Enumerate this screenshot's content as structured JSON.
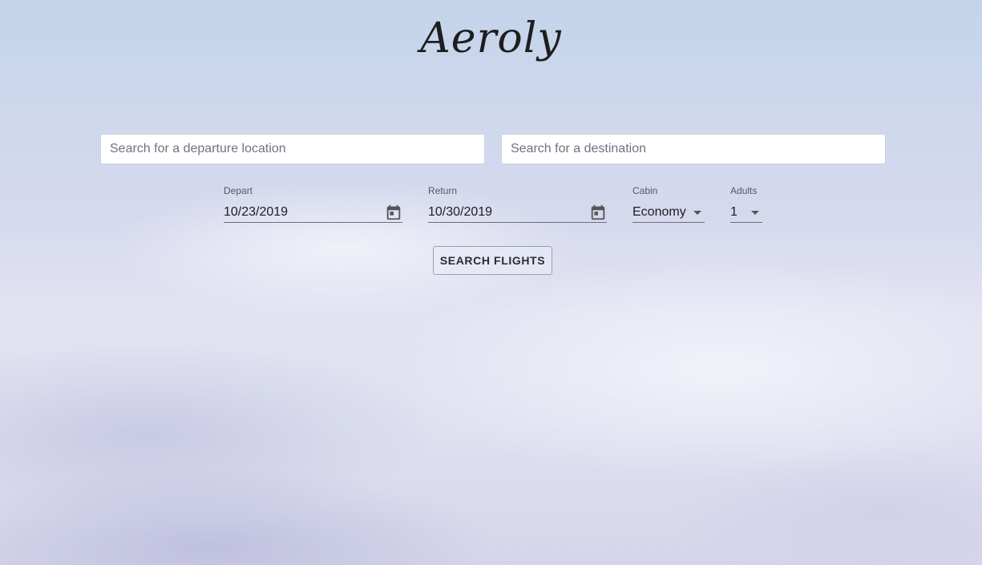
{
  "brand": {
    "name": "Aeroly"
  },
  "search": {
    "departure_placeholder": "Search for a departure location",
    "destination_placeholder": "Search for a destination",
    "button_label": "SEARCH FLIGHTS"
  },
  "fields": {
    "depart": {
      "label": "Depart",
      "value": "10/23/2019",
      "icon": "calendar-icon"
    },
    "return": {
      "label": "Return",
      "value": "10/30/2019",
      "icon": "calendar-icon"
    },
    "cabin": {
      "label": "Cabin",
      "value": "Economy",
      "icon": "caret-down-icon"
    },
    "adults": {
      "label": "Adults",
      "value": "1",
      "icon": "caret-down-icon"
    }
  },
  "colors": {
    "text": "#222222",
    "underline": "#6b6f79",
    "button_border": "#9aa0ab"
  }
}
